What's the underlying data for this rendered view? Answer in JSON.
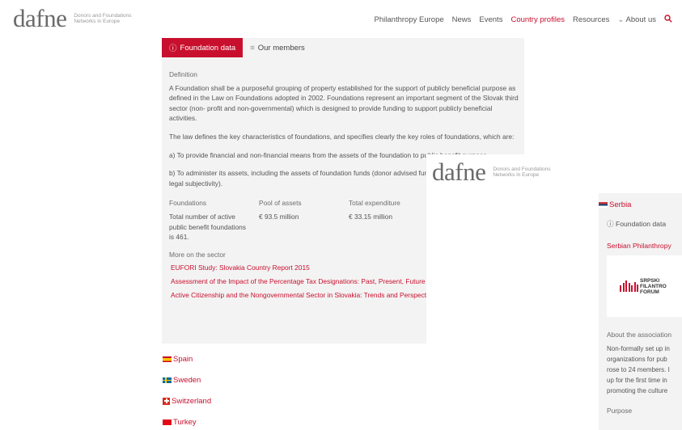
{
  "header": {
    "logo_word": "dafne",
    "logo_tagline_1": "Donors and Foundations",
    "logo_tagline_2": "Networks in Europe",
    "nav": [
      "Philanthropy Europe",
      "News",
      "Events",
      "Country profiles",
      "Resources"
    ],
    "nav_about": "About us",
    "active_nav": "Country profiles"
  },
  "tabs": {
    "foundation_data": "Foundation data",
    "our_members": "Our members"
  },
  "content": {
    "definition_heading": "Definition",
    "definition_text": "A Foundation shall be a purposeful grouping of property established for the support of publicly beneficial purpose as defined in the Law on Foundations adopted in 2002. Foundations represent an important segment of the Slovak third sector (non- profit and non-governmental) which is designed to provide funding to support publicly beneficial activities.",
    "law_text": "The law defines the key characteristics of foundations, and specifies clearly the key roles of foundations, which are:",
    "role_a": "a) To provide financial and non-financial means from the assets of the foundation to public benefit purpose.",
    "role_b": "b) To administer its assets, including the assets of foundation funds (donor advised funds to the foundation without a legal subjectivity).",
    "stats": [
      {
        "label": "Foundations",
        "value": "Total number of active public benefit foundations is 461."
      },
      {
        "label": "Pool of assets",
        "value": "€ 93.5 million"
      },
      {
        "label": "Total expenditure",
        "value": "€ 33.15 million"
      }
    ],
    "more_heading": "More on the sector",
    "links": [
      "EUFORI Study: Slovakia Country Report 2015",
      "Assessment of the Impact of the Percentage Tax Designations: Past, Present, Future",
      "Active Citizenship and the Nongovernmental Sector in Slovakia: Trends and Perspectives"
    ]
  },
  "countries": [
    "Spain",
    "Sweden",
    "Switzerland",
    "Turkey"
  ],
  "overlay": {
    "country": "Serbia",
    "foundation_data": "Foundation data",
    "org_name": "Serbian Philanthropy",
    "org_logo_lines": [
      "SRPSKI",
      "FILANTRO",
      "FORUM"
    ],
    "about_heading": "About the association",
    "about_lines": [
      "Non-formally set up in",
      "organizations for pub",
      "rose to 24 members. I",
      "up for the first time in",
      "promoting the culture"
    ],
    "purpose_heading": "Purpose"
  },
  "colors": {
    "accent": "#c8102e",
    "panel": "#f3f3f3"
  }
}
